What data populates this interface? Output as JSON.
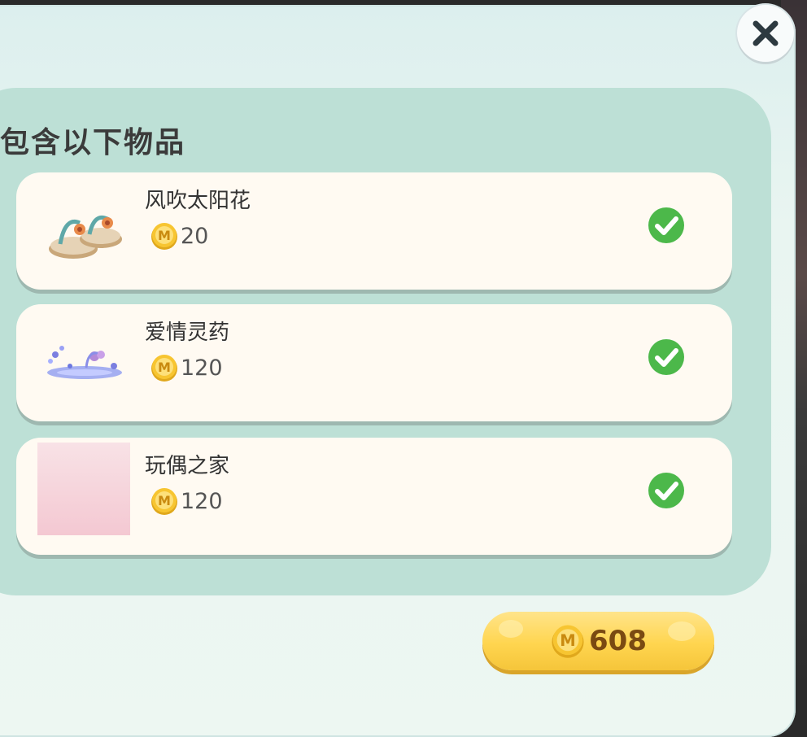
{
  "dialog": {
    "section_title": "包含以下物品",
    "close_icon": "close-icon"
  },
  "items": [
    {
      "name": "风吹太阳花",
      "price": "20",
      "owned": true,
      "thumb": "sandals-icon"
    },
    {
      "name": "爱情灵药",
      "price": "120",
      "owned": true,
      "thumb": "potion-effect-icon"
    },
    {
      "name": "玩偶之家",
      "price": "120",
      "owned": true,
      "thumb": "pink-placeholder"
    }
  ],
  "total": {
    "price": "608"
  },
  "colors": {
    "panel": "#e9f5f1",
    "inner": "#bde0d6",
    "card": "#fffaf2",
    "check": "#4cb84a",
    "coin": "#f7c531",
    "button": "#ffd54f"
  }
}
